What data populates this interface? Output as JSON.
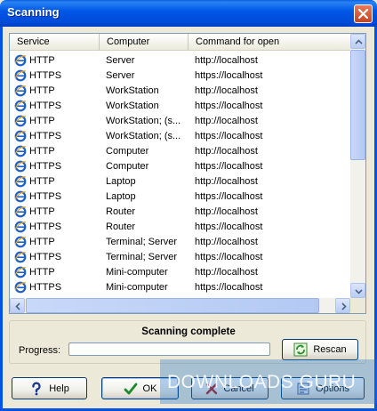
{
  "window": {
    "title": "Scanning"
  },
  "list": {
    "columns": [
      "Service",
      "Computer",
      "Command for open"
    ],
    "rows": [
      {
        "service": "HTTP",
        "computer": "Server",
        "command": "http://localhost"
      },
      {
        "service": "HTTPS",
        "computer": "Server",
        "command": "https://localhost"
      },
      {
        "service": "HTTP",
        "computer": "WorkStation",
        "command": "http://localhost"
      },
      {
        "service": "HTTPS",
        "computer": "WorkStation",
        "command": "https://localhost"
      },
      {
        "service": "HTTP",
        "computer": "WorkStation; (s...",
        "command": "http://localhost"
      },
      {
        "service": "HTTPS",
        "computer": "WorkStation; (s...",
        "command": "https://localhost"
      },
      {
        "service": "HTTP",
        "computer": "Computer",
        "command": "http://localhost"
      },
      {
        "service": "HTTPS",
        "computer": "Computer",
        "command": "https://localhost"
      },
      {
        "service": "HTTP",
        "computer": "Laptop",
        "command": "http://localhost"
      },
      {
        "service": "HTTPS",
        "computer": "Laptop",
        "command": "https://localhost"
      },
      {
        "service": "HTTP",
        "computer": "Router",
        "command": "http://localhost"
      },
      {
        "service": "HTTPS",
        "computer": "Router",
        "command": "https://localhost"
      },
      {
        "service": "HTTP",
        "computer": "Terminal; Server",
        "command": "http://localhost"
      },
      {
        "service": "HTTPS",
        "computer": "Terminal; Server",
        "command": "https://localhost"
      },
      {
        "service": "HTTP",
        "computer": "Mini-computer",
        "command": "http://localhost"
      },
      {
        "service": "HTTPS",
        "computer": "Mini-computer",
        "command": "https://localhost"
      }
    ]
  },
  "status": {
    "text": "Scanning complete",
    "progress_label": "Progress:",
    "progress_fraction": 0,
    "rescan_label": "Rescan"
  },
  "buttons": {
    "help": "Help",
    "ok": "OK",
    "cancel": "Cancel",
    "options": "Options"
  },
  "watermark": {
    "text": "DOWNLOADS GURU"
  },
  "icons": {
    "row_icon": "ie-icon",
    "rescan_icon": "refresh-icon",
    "help_icon": "help-icon",
    "ok_icon": "checkmark-icon",
    "cancel_icon": "cancel-icon",
    "options_icon": "options-icon"
  },
  "colors": {
    "titlebar": "#0058e6",
    "progress": "#3db03d"
  }
}
